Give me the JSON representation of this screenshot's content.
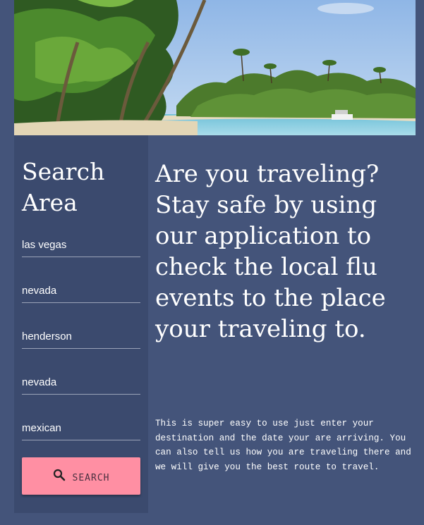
{
  "sidebar": {
    "title": "Search Area",
    "fields": [
      {
        "value": "las vegas"
      },
      {
        "value": "nevada"
      },
      {
        "value": "henderson"
      },
      {
        "value": "nevada"
      },
      {
        "value": "mexican"
      }
    ],
    "search_button": {
      "label": "SEARCH",
      "icon": "search-icon"
    }
  },
  "main": {
    "headline": "Are you traveling? Stay safe by using our application to check the local flu events to the place your traveling to.",
    "description": "This is super easy to use just enter your destination and the date your are arriving. You can also tell us how you are traveling there and we will give you the best route to travel."
  },
  "colors": {
    "background": "#44547a",
    "sidebar": "#3b4a6e",
    "button": "#ff8fa3",
    "text": "#ffffff"
  }
}
